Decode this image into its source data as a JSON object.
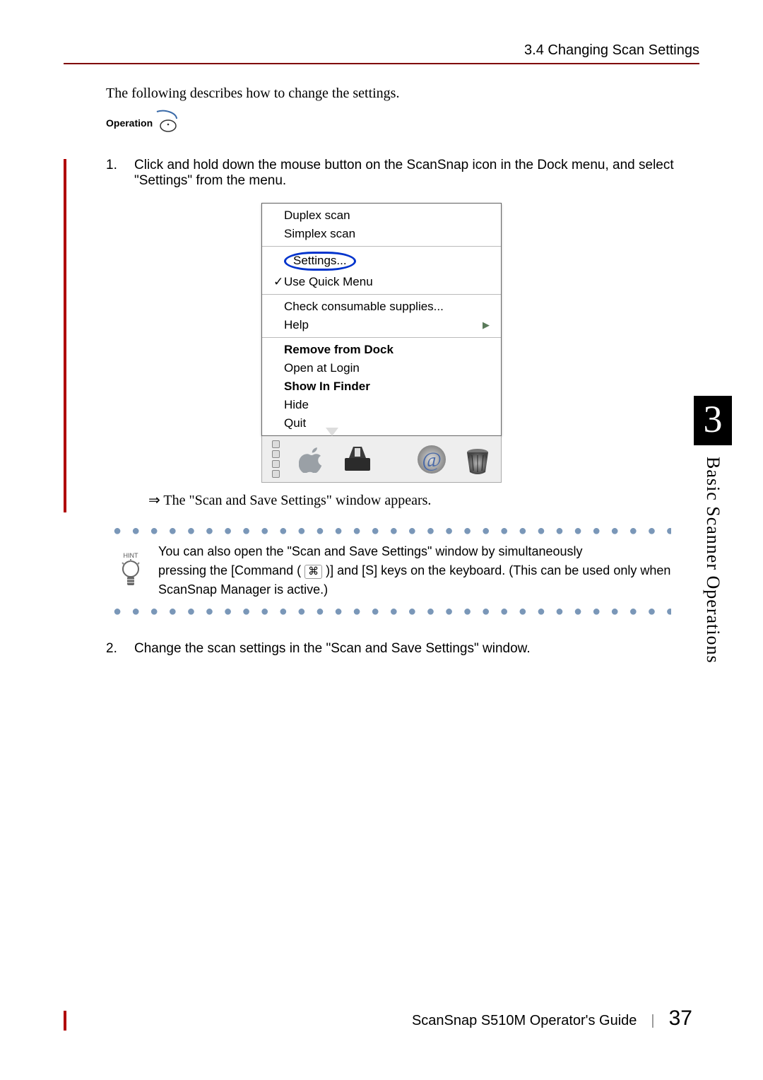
{
  "header": {
    "section": "3.4 Changing Scan Settings"
  },
  "intro": "The following describes how to change the settings.",
  "operation_label": "Operation",
  "steps": {
    "s1": {
      "num": "1.",
      "text": "Click and hold down the mouse button on the ScanSnap icon in the Dock menu, and select \"Settings\" from the menu."
    },
    "s2": {
      "num": "2.",
      "text": "Change the scan settings in the \"Scan and Save Settings\" window."
    }
  },
  "menu": {
    "duplex": "Duplex scan",
    "simplex": "Simplex scan",
    "settings": "Settings...",
    "quick": "Use Quick Menu",
    "consumable": "Check consumable supplies...",
    "help": "Help",
    "remove": "Remove from Dock",
    "open_login": "Open at Login",
    "show_finder": "Show In Finder",
    "hide": "Hide",
    "quit": "Quit"
  },
  "result": "The \"Scan and Save Settings\" window appears.",
  "hint": {
    "label": "HINT",
    "line1": "You can also open the \"Scan and Save Settings\" window by simultaneously",
    "line2a": "pressing the [Command ( ",
    "line2b": " )] and [S] keys on the keyboard. (This can be used only when ScanSnap Manager is active.)"
  },
  "side": {
    "chapter": "3",
    "label": "Basic Scanner Operations"
  },
  "footer": {
    "guide": "ScanSnap  S510M Operator's Guide",
    "page": "37"
  }
}
